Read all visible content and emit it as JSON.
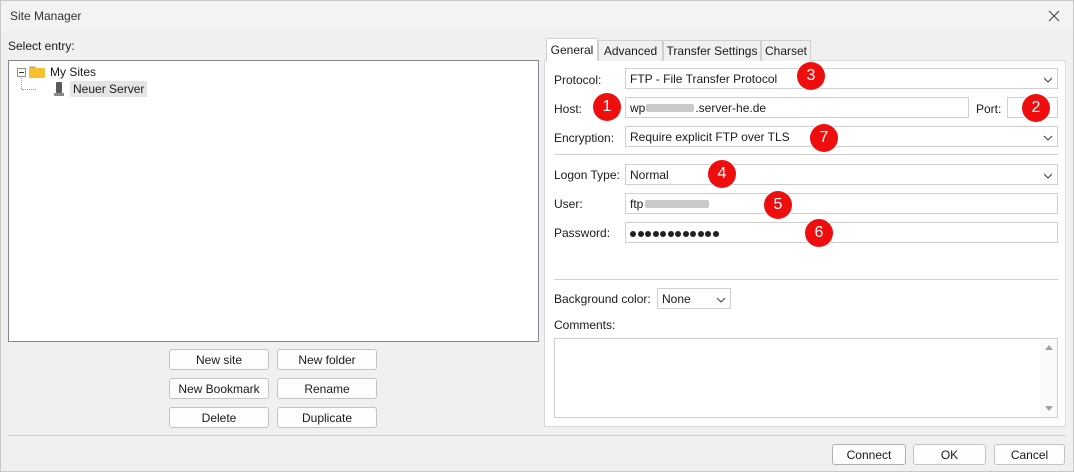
{
  "window": {
    "title": "Site Manager"
  },
  "left": {
    "select_entry_label": "Select entry:",
    "tree": {
      "root_label": "My Sites",
      "child_label": "Neuer Server"
    },
    "buttons": {
      "new_site": "New site",
      "new_folder": "New folder",
      "new_bookmark": "New Bookmark",
      "rename": "Rename",
      "delete": "Delete",
      "duplicate": "Duplicate"
    }
  },
  "tabs": [
    "General",
    "Advanced",
    "Transfer Settings",
    "Charset"
  ],
  "general": {
    "protocol_label": "Protocol:",
    "protocol_value": "FTP - File Transfer Protocol",
    "host_label": "Host:",
    "host_prefix": "wp",
    "host_suffix": ".server-he.de",
    "port_label": "Port:",
    "port_value": "",
    "encryption_label": "Encryption:",
    "encryption_value": "Require explicit FTP over TLS",
    "logon_type_label": "Logon Type:",
    "logon_type_value": "Normal",
    "user_label": "User:",
    "user_prefix": "ftp",
    "password_label": "Password:",
    "password_length": 12,
    "background_color_label": "Background color:",
    "background_color_value": "None",
    "comments_label": "Comments:"
  },
  "markers": [
    "1",
    "2",
    "3",
    "4",
    "5",
    "6",
    "7"
  ],
  "footer": {
    "connect": "Connect",
    "ok": "OK",
    "cancel": "Cancel"
  },
  "colors": {
    "marker_red": "#ee0e0e",
    "folder_yellow": "#f7c12b"
  }
}
